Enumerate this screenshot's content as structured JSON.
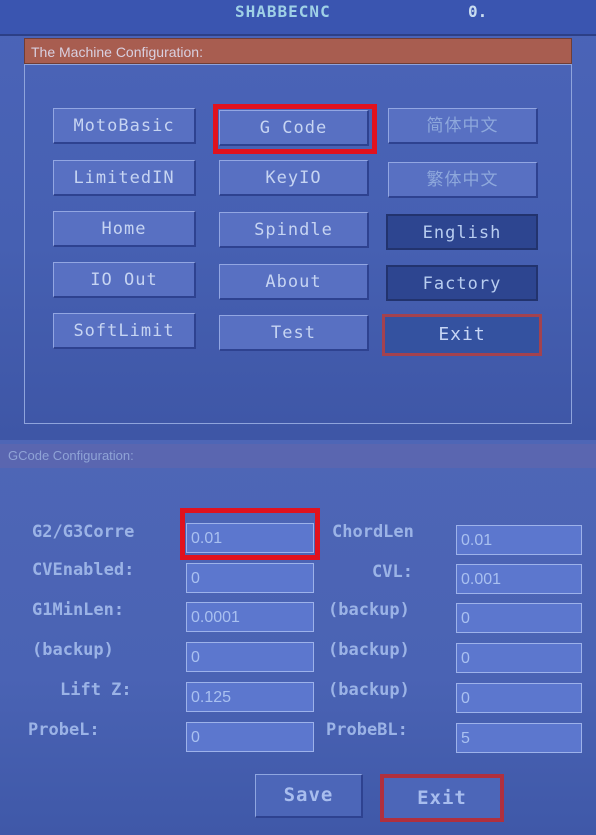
{
  "header": {
    "brand": "SHABBECNC",
    "number": "0."
  },
  "config_title": "The Machine Configuration:",
  "config_buttons": {
    "moto_basic": "MotoBasic",
    "g_code": "G Code",
    "simplified_chinese": "简体中文",
    "limited_in": "LimitedIN",
    "key_io": "KeyIO",
    "traditional_chinese": "繁体中文",
    "home": "Home",
    "spindle": "Spindle",
    "english": "English",
    "io_out": "IO Out",
    "about": "About",
    "factory": "Factory",
    "soft_limit": "SoftLimit",
    "test": "Test",
    "exit": "Exit"
  },
  "gcode_config": {
    "title": "GCode Configuration:",
    "rows": [
      {
        "left_label": "G2/G3Corre",
        "left_value": "0.01",
        "right_label": "ChordLen",
        "right_value": "0.01"
      },
      {
        "left_label": "CVEnabled:",
        "left_value": "0",
        "right_label": "CVL:",
        "right_value": "0.001"
      },
      {
        "left_label": "G1MinLen:",
        "left_value": "0.0001",
        "right_label": "(backup)",
        "right_value": "0"
      },
      {
        "left_label": "(backup)",
        "left_value": "0",
        "right_label": "(backup)",
        "right_value": "0"
      },
      {
        "left_label": "Lift Z:",
        "left_value": "0.125",
        "right_label": "(backup)",
        "right_value": "0"
      },
      {
        "left_label": "ProbeL:",
        "left_value": "0",
        "right_label": "ProbeBL:",
        "right_value": "5"
      }
    ],
    "save": "Save",
    "exit": "Exit"
  }
}
